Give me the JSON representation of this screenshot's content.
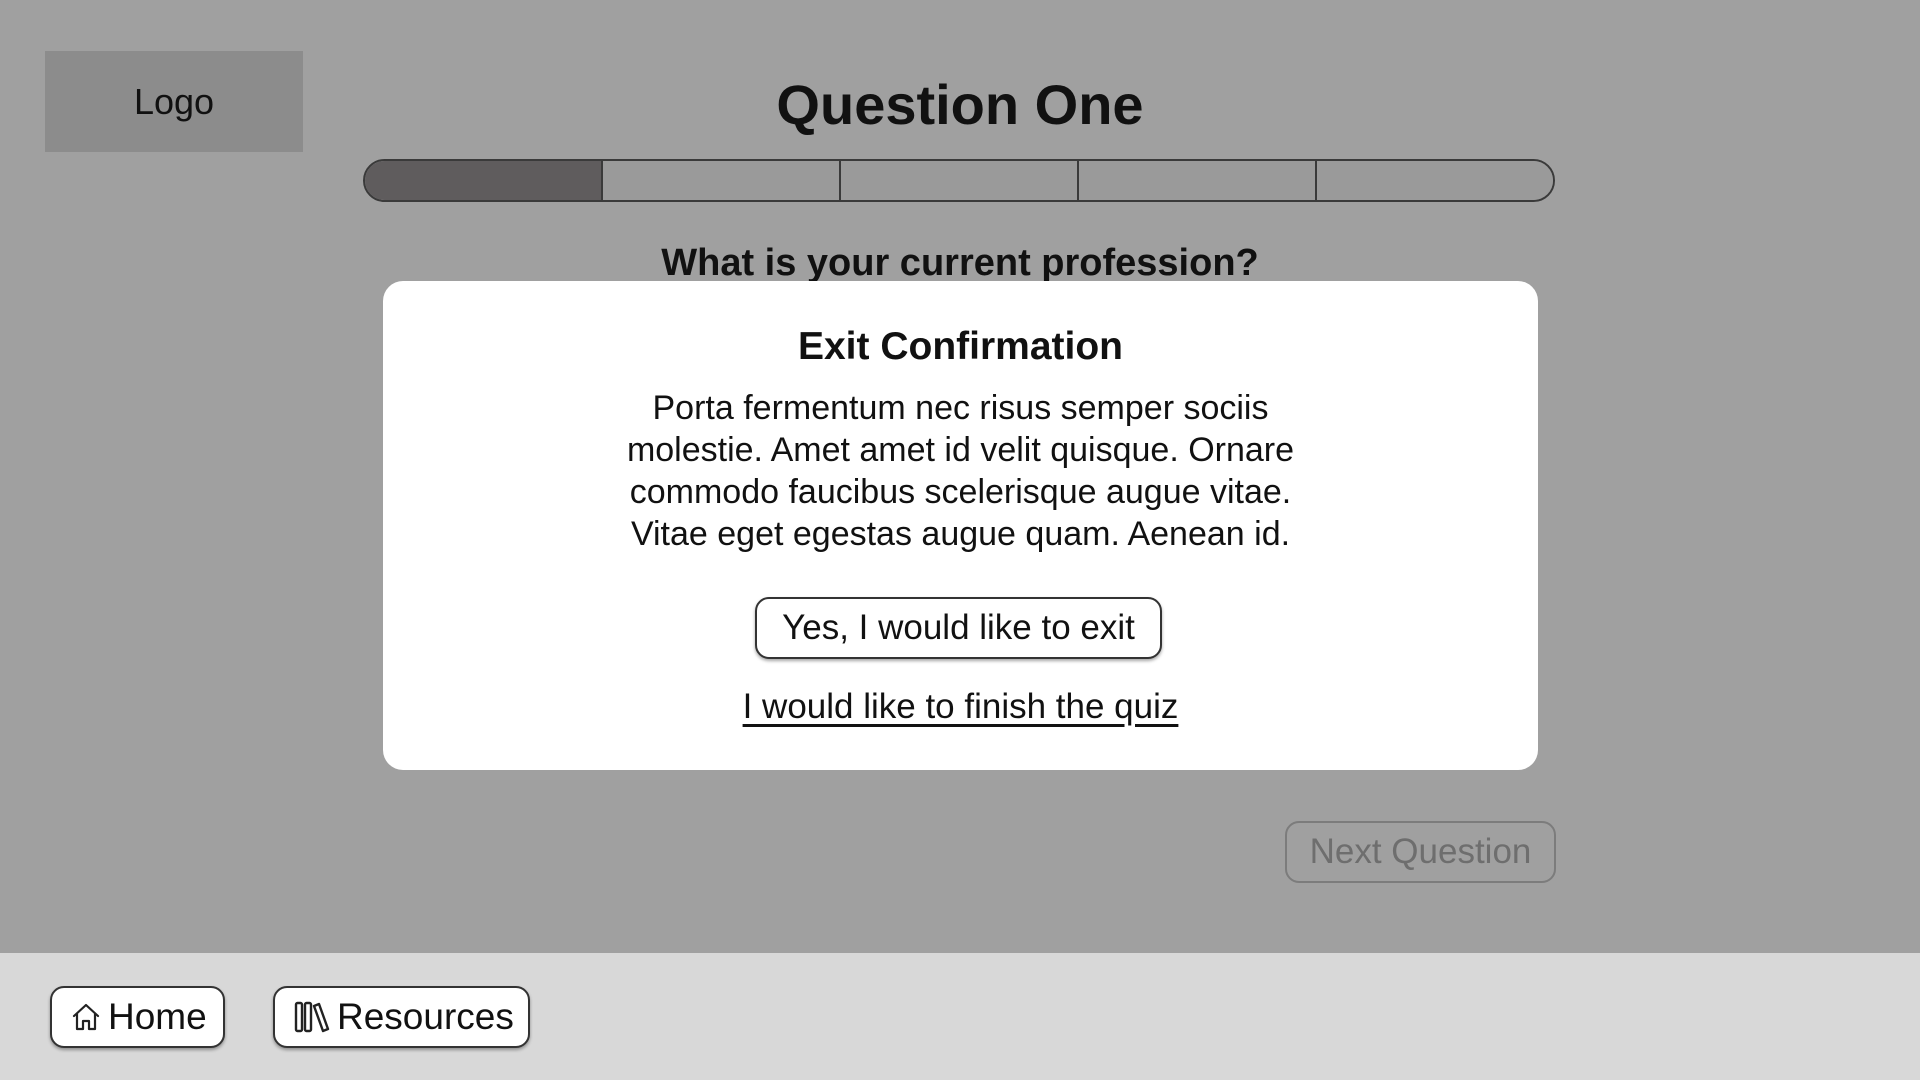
{
  "header": {
    "logo_text": "Logo",
    "title": "Question One"
  },
  "progress": {
    "total_steps": 5,
    "completed_steps": 1
  },
  "question": {
    "text": "What is your current profession?"
  },
  "modal": {
    "title": "Exit Confirmation",
    "body_lines": [
      "Porta fermentum nec risus semper sociis",
      "molestie. Amet amet id velit quisque. Ornare",
      "commodo faucibus scelerisque augue vitae.",
      "Vitae eget egestas augue quam. Aenean id."
    ],
    "confirm_label": "Yes, I would like to exit",
    "cancel_label": "I would like to finish the quiz"
  },
  "actions": {
    "next_label": "Next Question"
  },
  "footer": {
    "home_label": "Home",
    "home_icon": "home-icon",
    "resources_label": "Resources",
    "resources_icon": "books-icon"
  },
  "colors": {
    "overlay_background": "#a0a0a0",
    "footer_background": "#d8d8d8",
    "progress_done": "#5f5c5d",
    "modal_background": "#ffffff"
  }
}
